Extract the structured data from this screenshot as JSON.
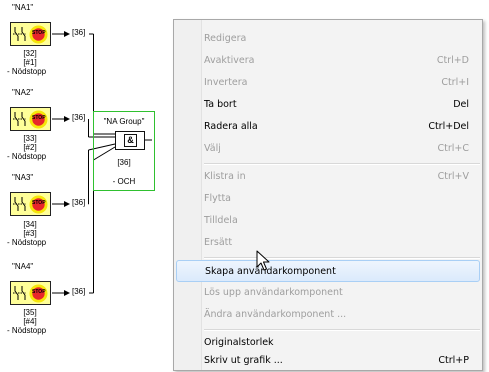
{
  "diagram": {
    "components": [
      {
        "name": "\"NA1\"",
        "ref": "[32]",
        "idx": "[#1]",
        "desc": "- Nödstopp",
        "arrow_ref": "[36]"
      },
      {
        "name": "\"NA2\"",
        "ref": "[33]",
        "idx": "[#2]",
        "desc": "- Nödstopp",
        "arrow_ref": "[36]"
      },
      {
        "name": "\"NA3\"",
        "ref": "[34]",
        "idx": "[#3]",
        "desc": "- Nödstopp",
        "arrow_ref": "[36]"
      },
      {
        "name": "\"NA4\"",
        "ref": "[35]",
        "idx": "[#4]",
        "desc": "- Nödstopp",
        "arrow_ref": "[36]"
      }
    ],
    "stop_text": "STOP",
    "group": {
      "name": "\"NA Group\"",
      "block_symbol": "&",
      "ref": "[36]",
      "desc": "- OCH"
    },
    "colors": {
      "component_fill": "#ffff99",
      "group_border": "#2fc02f",
      "stop_red": "#e8262a",
      "stop_yellow": "#f6e60a"
    }
  },
  "context_menu": {
    "items": [
      {
        "label": "Redigera",
        "shortcut": "",
        "enabled": false,
        "highlighted": false
      },
      {
        "label": "Avaktivera",
        "shortcut": "Ctrl+D",
        "enabled": false,
        "highlighted": false
      },
      {
        "label": "Invertera",
        "shortcut": "Ctrl+I",
        "enabled": false,
        "highlighted": false
      },
      {
        "label": "Ta bort",
        "shortcut": "Del",
        "enabled": true,
        "highlighted": false
      },
      {
        "label": "Radera alla",
        "shortcut": "Ctrl+Del",
        "enabled": true,
        "highlighted": false
      },
      {
        "label": "Välj",
        "shortcut": "Ctrl+C",
        "enabled": false,
        "highlighted": false
      },
      {
        "label": "Klistra in",
        "shortcut": "Ctrl+V",
        "enabled": false,
        "highlighted": false
      },
      {
        "label": "Flytta",
        "shortcut": "",
        "enabled": false,
        "highlighted": false
      },
      {
        "label": "Tilldela",
        "shortcut": "",
        "enabled": false,
        "highlighted": false
      },
      {
        "label": "Ersätt",
        "shortcut": "",
        "enabled": false,
        "highlighted": false
      },
      {
        "label": "Skapa användarkomponent",
        "shortcut": "",
        "enabled": true,
        "highlighted": true
      },
      {
        "label": "Lös upp användarkomponent",
        "shortcut": "",
        "enabled": false,
        "highlighted": false
      },
      {
        "label": "Ändra användarkomponent ...",
        "shortcut": "",
        "enabled": false,
        "highlighted": false
      },
      {
        "label": "Originalstorlek",
        "shortcut": "",
        "enabled": true,
        "highlighted": false
      },
      {
        "label": "Skriv ut grafik ...",
        "shortcut": "Ctrl+P",
        "enabled": true,
        "highlighted": false
      }
    ]
  }
}
